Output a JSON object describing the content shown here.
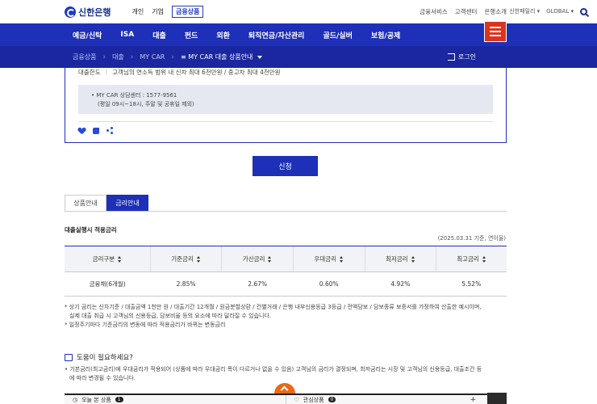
{
  "header": {
    "logo": "신한은행",
    "biz_tabs": [
      "개인",
      "기업",
      "금융상품"
    ],
    "top_links": [
      "금융서비스",
      "고객센터",
      "은행소개"
    ],
    "family": "신한패밀리",
    "global": "GLOBAL"
  },
  "nav": [
    "예금/신탁",
    "ISA",
    "대출",
    "펀드",
    "외환",
    "퇴직연금/자산관리",
    "골드/실버",
    "보험/공제"
  ],
  "breadcrumb": [
    "금융상품",
    "대출",
    "MY CAR",
    "MY CAR 대출 상품안내"
  ],
  "login": "로그인",
  "info": {
    "limit_label": "대출한도",
    "limit_value": "고객님의 연소득 범위 내 신차 최대 6천만원 / 중고차 최대 4천만원",
    "contact_line1": "MY CAR 상담센터 : 1577-9561",
    "contact_line2": "(평일 09시~18시, 주말 및 공휴일 제외)"
  },
  "apply": "신청",
  "tabs": [
    "상품안내",
    "금리안내"
  ],
  "section_title": "대출실행시 적용금리",
  "ref_date": "(2025.03.31 기준, 연이율)",
  "table": {
    "headers": [
      "금리구분",
      "기준금리",
      "가산금리",
      "우대금리",
      "최저금리",
      "최고금리"
    ],
    "row": [
      "금융채(6개월)",
      "2.85%",
      "2.67%",
      "0.60%",
      "4.92%",
      "5.52%"
    ]
  },
  "notes": [
    "* 상기 금리는 신차기준 / 대출금액 1천만 원 / 대출기간 12개월 / 원금분할상환 / 건별거래 / 은행 내부신용등급 3등급 / 전액담보 / 담보종류 보증서를 가정하여 산출한 예시이며,",
    "실제 대출 취급 시 고객님의 신용등급, 담보비율 등의 요소에 따라 달라질 수 있습니다.",
    "* 일정주기마다 기준금리의 변동에 따라 적용금리가 바뀌는 변동금리"
  ],
  "help": {
    "title": "도움이 필요하세요?",
    "line1": "• 기본금리(최고금리)에 우대금리가 적용되어 (상품에 따라 우대금리 폭이 다르거나 없을 수 있음) 고객님의 금리가 결정되며, 최저금리는 시장 및 고객님의 신용등급, 대출조건 등",
    "line2": "에 따라 변경될 수 있습니다."
  },
  "bottom": {
    "recent_label": "오늘 본 상품",
    "recent_count": "1",
    "fav_label": "관심상품",
    "fav_count": "0",
    "plus": "+"
  }
}
